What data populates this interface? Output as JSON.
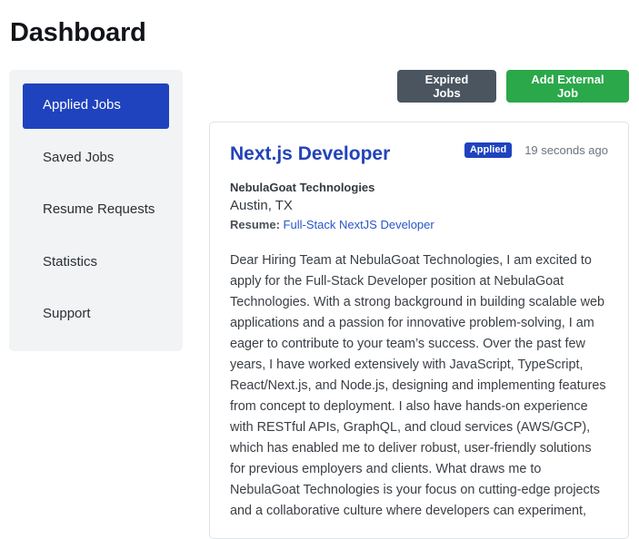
{
  "page": {
    "title": "Dashboard"
  },
  "sidebar": {
    "items": [
      {
        "label": "Applied Jobs",
        "active": true
      },
      {
        "label": "Saved Jobs",
        "active": false
      },
      {
        "label": "Resume Requests",
        "active": false
      },
      {
        "label": "Statistics",
        "active": false
      },
      {
        "label": "Support",
        "active": false
      }
    ]
  },
  "actions": {
    "expired_label": "Expired Jobs",
    "add_external_label": "Add External Job"
  },
  "job": {
    "title": "Next.js Developer",
    "status": "Applied",
    "time_ago": "19 seconds ago",
    "company": "NebulaGoat Technologies",
    "location": "Austin, TX",
    "resume_label": "Resume:",
    "resume_name": "Full-Stack NextJS Developer",
    "cover_letter": "Dear Hiring Team at NebulaGoat Technologies, I am excited to apply for the Full-Stack Developer position at NebulaGoat Technologies. With a strong background in building scalable web applications and a passion for innovative problem-solving, I am eager to contribute to your team’s success. Over the past few years, I have worked extensively with JavaScript, TypeScript, React/Next.js, and Node.js, designing and implementing features from concept to deployment. I also have hands-on experience with RESTful APIs, GraphQL, and cloud services (AWS/GCP), which has enabled me to deliver robust, user-friendly solutions for previous employers and clients. What draws me to NebulaGoat Technologies is your focus on cutting-edge projects and a collaborative culture where developers can experiment,"
  },
  "colors": {
    "accent": "#1f43be",
    "title_link": "#2343b8",
    "success": "#2aa84a",
    "secondary": "#4b5560",
    "sidebar_bg": "#f1f3f5"
  }
}
